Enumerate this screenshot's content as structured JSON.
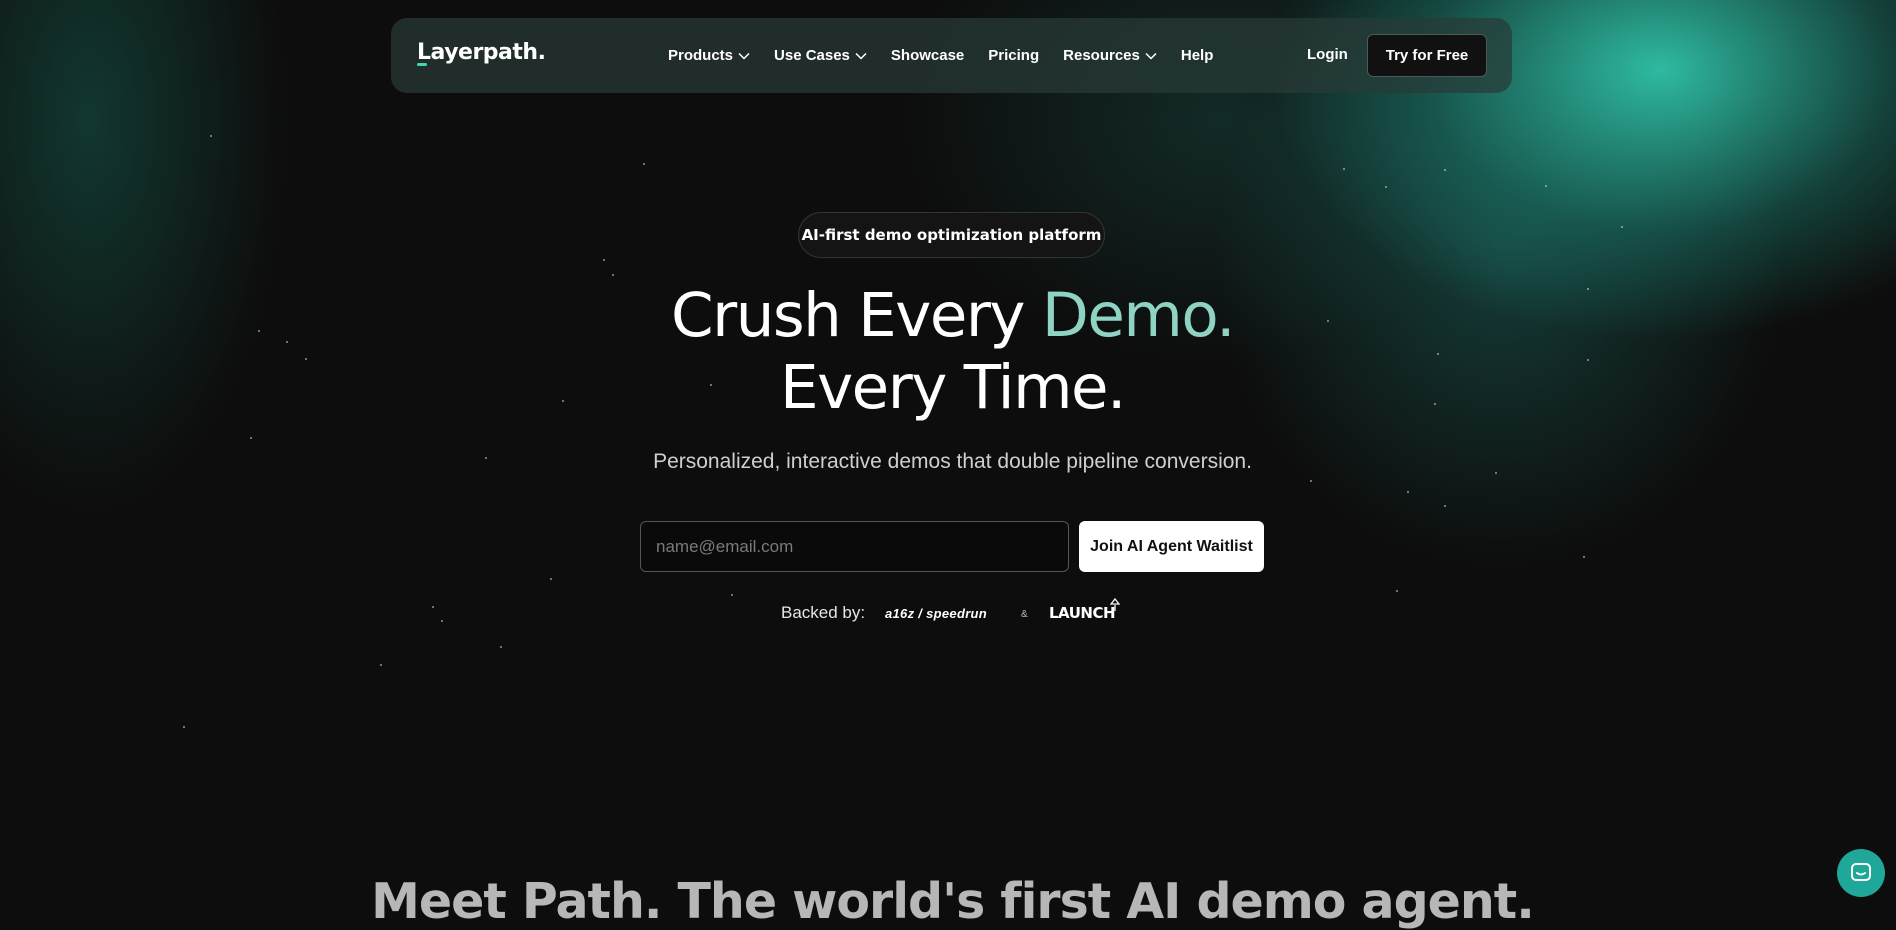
{
  "brand": {
    "logo_text": "Layerpath.",
    "accent_color": "#3fd6b5"
  },
  "nav": {
    "items": [
      {
        "label": "Products",
        "has_dropdown": true
      },
      {
        "label": "Use Cases",
        "has_dropdown": true
      },
      {
        "label": "Showcase",
        "has_dropdown": false
      },
      {
        "label": "Pricing",
        "has_dropdown": false
      },
      {
        "label": "Resources",
        "has_dropdown": true
      },
      {
        "label": "Help",
        "has_dropdown": false
      }
    ],
    "login": "Login",
    "cta": "Try for Free"
  },
  "hero": {
    "badge": "AI-first demo optimization platform",
    "headline_part1": "Crush Every ",
    "headline_accent": "Demo.",
    "headline_line2": "Every Time.",
    "subtitle": "Personalized, interactive demos that double pipeline conversion.",
    "email_placeholder": "name@email.com",
    "waitlist_button": "Join AI Agent Waitlist",
    "backed_label": "Backed by:",
    "backers": [
      "a16z / speedrun",
      "LAUNCH"
    ],
    "backer_separator": "&"
  },
  "next_section": {
    "heading": "Meet Path. The world's first AI demo agent."
  },
  "chat_widget": {
    "icon": "chat-bubble-icon"
  }
}
